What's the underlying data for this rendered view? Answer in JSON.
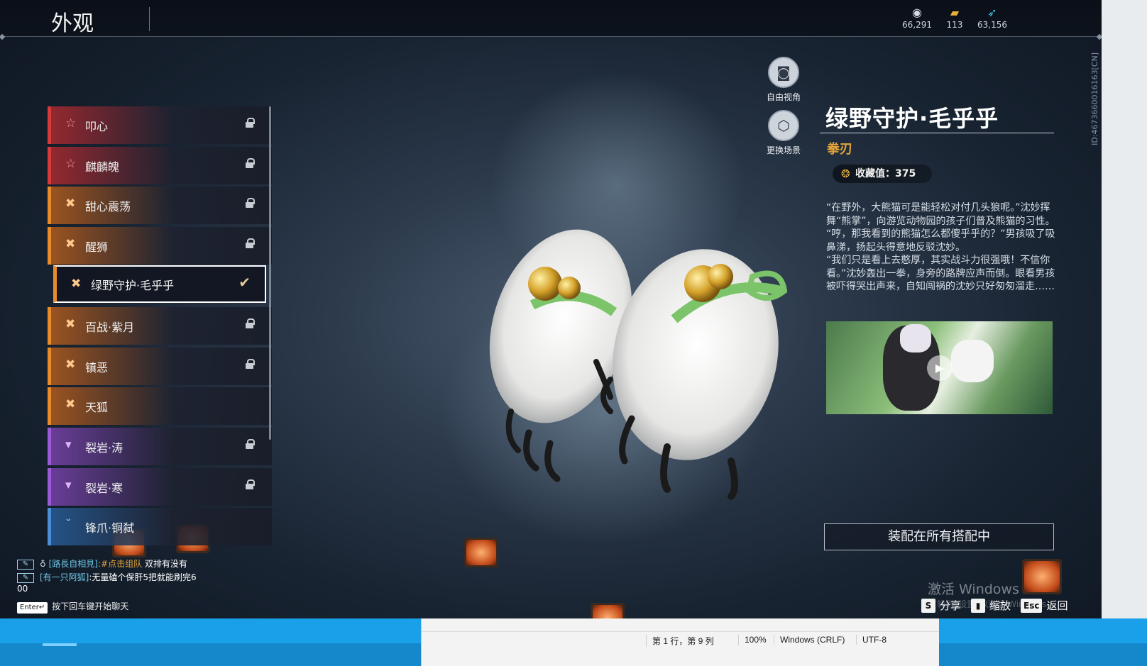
{
  "header": {
    "title": "外观",
    "currencies": [
      {
        "icon": "coin-stack-icon",
        "value": "66,291"
      },
      {
        "icon": "ticket-icon",
        "value": "113"
      },
      {
        "icon": "feather-icon",
        "value": "63,156"
      }
    ]
  },
  "outfit_list": [
    {
      "label": "叩心",
      "icon": "star-rarity-icon",
      "rarity_color": "#d63a3a",
      "locked": true
    },
    {
      "label": "麒麟魄",
      "icon": "star-rarity-icon",
      "rarity_color": "#d63a3a",
      "locked": true
    },
    {
      "label": "甜心震荡",
      "icon": "cross-rarity-icon",
      "rarity_color": "#e98a2b",
      "locked": true
    },
    {
      "label": "醒狮",
      "icon": "cross-rarity-icon",
      "rarity_color": "#e98a2b",
      "locked": true
    },
    {
      "label": "绿野守护·毛乎乎",
      "icon": "cross-rarity-icon",
      "rarity_color": "#e98a2b",
      "locked": false,
      "selected": true
    },
    {
      "label": "百战·紫月",
      "icon": "cross-rarity-icon",
      "rarity_color": "#e98a2b",
      "locked": true
    },
    {
      "label": "镇恶",
      "icon": "cross-rarity-icon",
      "rarity_color": "#e98a2b",
      "locked": true
    },
    {
      "label": "天狐",
      "icon": "cross-rarity-icon",
      "rarity_color": "#e98a2b",
      "locked": false
    },
    {
      "label": "裂岩·涛",
      "icon": "wing-rarity-icon",
      "rarity_color": "#9b5ad6",
      "locked": true
    },
    {
      "label": "裂岩·寒",
      "icon": "wing-rarity-icon",
      "rarity_color": "#9b5ad6",
      "locked": true
    },
    {
      "label": "锋爪·铜弑",
      "icon": "wing-rarity-icon",
      "rarity_color": "#4a8ed6",
      "locked": false
    }
  ],
  "view_controls": {
    "free_view": "自由视角",
    "change_scene": "更换场景"
  },
  "detail": {
    "name": "绿野守护·毛乎乎",
    "type": "拳刃",
    "collection": "收藏值：375",
    "description": [
      "“在野外，大熊猫可是能轻松对付几头狼呢。”沈妙挥舞“熊掌”，向游览动物园的孩子们普及熊猫的习性。",
      "“哼，那我看到的熊猫怎么都傻乎乎的？”男孩吸了吸鼻涕，扬起头得意地反驳沈妙。",
      "“我们只是看上去憨厚，其实战斗力很强哦！不信你看。”沈妙轰出一拳，身旁的路牌应声而倒。眼看男孩被吓得哭出声来，自知闯祸的沈妙只好匆匆溜走……"
    ],
    "equip_button": "装配在所有搭配中",
    "uid": "ID:4673660016163[CN]"
  },
  "chat": {
    "messages": [
      {
        "channel": "[路長自相見]",
        "link": ":#点击组队",
        "text": " 双排有没有"
      },
      {
        "channel": "[有一只阿狐]",
        "link": "",
        "text": ":无量磕个保肝5把就能刷完6"
      }
    ],
    "overflow_line": "00",
    "enter_key": "Enter↵",
    "hint": "按下回车键开始聊天"
  },
  "actions": {
    "share_key": "S",
    "share": "分享",
    "zoom": "缩放",
    "back_key": "Esc",
    "back": "返回"
  },
  "os_overlay": {
    "watermark": "激活 Windows",
    "watermark_sub": "转到“设置”以激活 Windows。",
    "status_pos": "第 1 行，第 9 列",
    "status_zoom": "100%",
    "status_eol": "Windows (CRLF)",
    "status_enc": "UTF-8"
  }
}
